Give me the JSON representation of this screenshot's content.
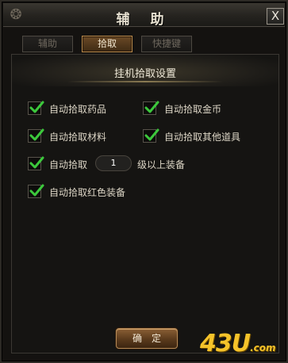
{
  "window": {
    "title": "辅 助",
    "close_label": "X"
  },
  "tabs": [
    {
      "label": "辅助",
      "active": false
    },
    {
      "label": "拾取",
      "active": true
    },
    {
      "label": "快捷键",
      "active": false
    }
  ],
  "section": {
    "title": "挂机拾取设置"
  },
  "options": {
    "pickup_medicine": {
      "label": "自动拾取药品",
      "checked": true
    },
    "pickup_gold": {
      "label": "自动拾取金币",
      "checked": true
    },
    "pickup_materials": {
      "label": "自动拾取材料",
      "checked": true
    },
    "pickup_other_items": {
      "label": "自动拾取其他道具",
      "checked": true
    },
    "pickup_level_equipment": {
      "label": "自动拾取",
      "checked": true,
      "level_value": "1",
      "suffix": "级以上装备"
    },
    "pickup_red_equipment": {
      "label": "自动拾取红色装备",
      "checked": true
    }
  },
  "footer": {
    "confirm_label": "确定"
  },
  "watermark": {
    "main": "43U",
    "suffix": ".com"
  },
  "colors": {
    "check_green": "#3cc83c",
    "accent_gold": "#b98a4b",
    "watermark_yellow": "#f5c32a"
  }
}
